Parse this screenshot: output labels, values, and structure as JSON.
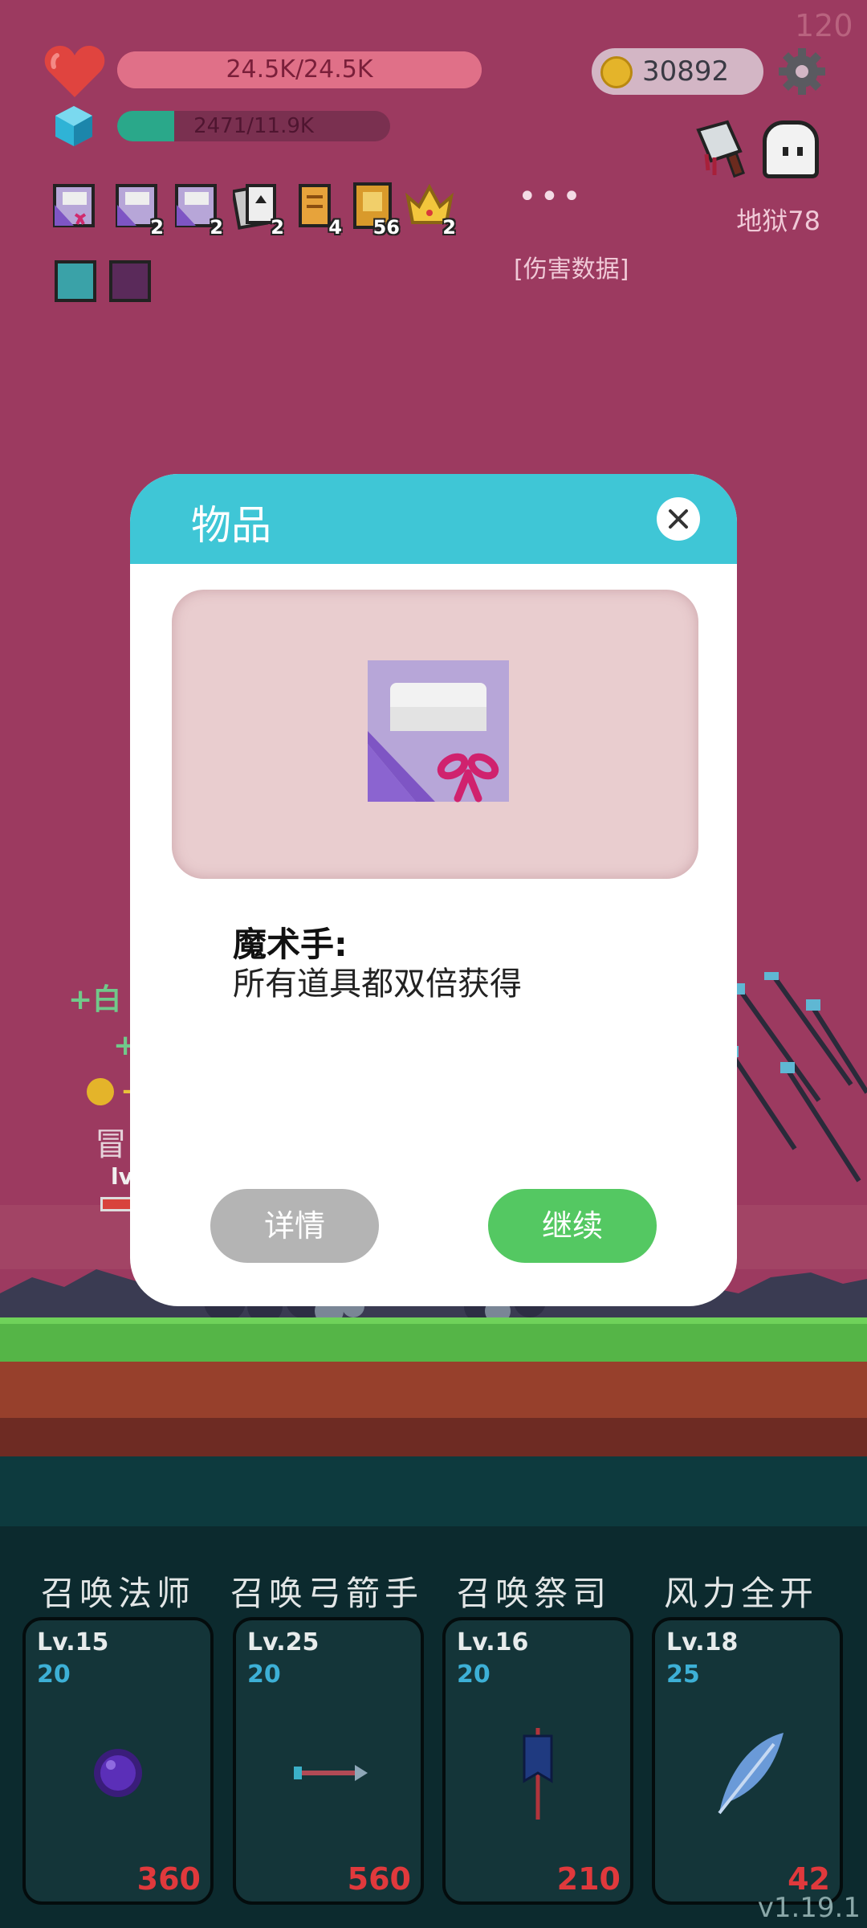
{
  "fps": "120",
  "hud": {
    "hp_text": "24.5K/24.5K",
    "hp_fraction": 1.0,
    "xp_text": "2471/11.9K",
    "xp_fraction": 0.21,
    "coins": "30892",
    "stage": "地狱78",
    "damage_data": "[伤害数据]",
    "more": "•••"
  },
  "items": [
    {
      "icon": "magic-hand-card-icon",
      "count": ""
    },
    {
      "icon": "magic-hand-card-icon",
      "count": "2"
    },
    {
      "icon": "magic-hand-card-icon",
      "count": "2"
    },
    {
      "icon": "playing-cards-icon",
      "count": "2"
    },
    {
      "icon": "scroll-icon",
      "count": "4"
    },
    {
      "icon": "book-icon",
      "count": "56"
    },
    {
      "icon": "crown-icon",
      "count": "2"
    }
  ],
  "battle_text": {
    "line1": "+白",
    "line2": "+",
    "line3": "+",
    "adventurer": "冒",
    "lv": "lv"
  },
  "modal": {
    "title": "物品",
    "item_name": "魔术手:",
    "item_desc": "所有道具都双倍获得",
    "detail_label": "详情",
    "continue_label": "继续"
  },
  "skills": [
    {
      "name": "召唤法师",
      "level": "Lv.15",
      "cost": "20",
      "value": "360",
      "icon": "purple-orb-icon"
    },
    {
      "name": "召唤弓箭手",
      "level": "Lv.25",
      "cost": "20",
      "value": "560",
      "icon": "arrow-icon"
    },
    {
      "name": "召唤祭司",
      "level": "Lv.16",
      "cost": "20",
      "value": "210",
      "icon": "banner-icon"
    },
    {
      "name": "风力全开",
      "level": "Lv.18",
      "cost": "25",
      "value": "42",
      "icon": "feather-icon"
    }
  ],
  "version": "v1.19.1",
  "colors": {
    "background": "#9c3a60",
    "modal_header": "#3fc6d6",
    "continue_button": "#54c862",
    "detail_button": "#b4b4b4",
    "skill_value": "#e0393c"
  }
}
